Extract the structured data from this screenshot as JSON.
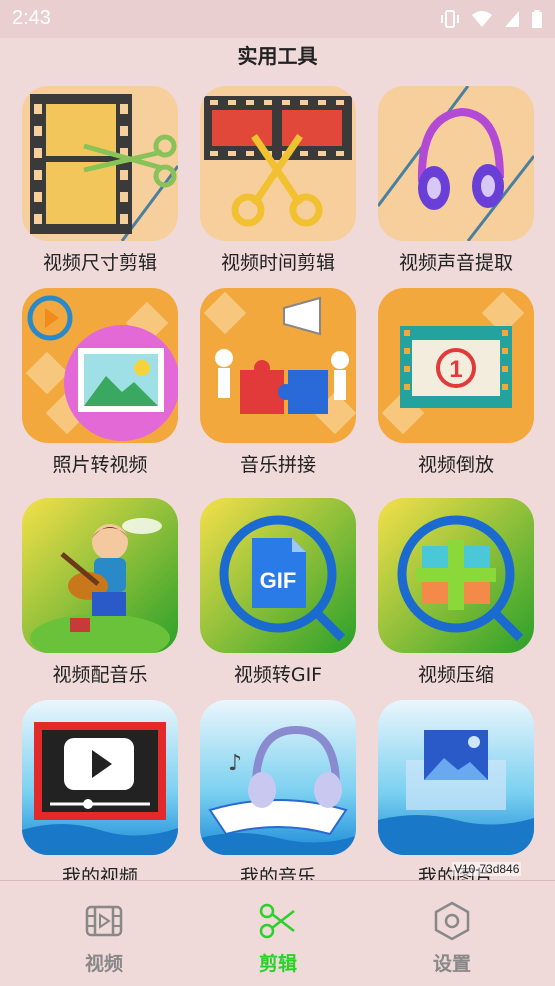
{
  "status_bar": {
    "time": "2:43"
  },
  "page_title": "实用工具",
  "tools": [
    {
      "label": "视频尺寸剪辑",
      "icon": "film-scissors-icon"
    },
    {
      "label": "视频时间剪辑",
      "icon": "film-cut-icon"
    },
    {
      "label": "视频声音提取",
      "icon": "headphones-icon"
    },
    {
      "label": "照片转视频",
      "icon": "photo-video-icon"
    },
    {
      "label": "音乐拼接",
      "icon": "puzzle-icon"
    },
    {
      "label": "视频倒放",
      "icon": "film-countdown-icon"
    },
    {
      "label": "视频配音乐",
      "icon": "boy-guitar-icon"
    },
    {
      "label": "视频转GIF",
      "icon": "gif-file-icon"
    },
    {
      "label": "视频压缩",
      "icon": "compress-icon"
    },
    {
      "label": "我的视频",
      "icon": "my-video-icon"
    },
    {
      "label": "我的音乐",
      "icon": "my-music-icon"
    },
    {
      "label": "我的图片",
      "icon": "my-picture-icon"
    }
  ],
  "watermark": "V10-73d846",
  "bottom_nav": [
    {
      "label": "视频",
      "icon": "film-icon",
      "active": false
    },
    {
      "label": "剪辑",
      "icon": "scissors-icon",
      "active": true
    },
    {
      "label": "设置",
      "icon": "settings-hexagon-icon",
      "active": false
    }
  ],
  "colors": {
    "active": "#2ad12a",
    "inactive": "#888888",
    "background": "#efd9d9"
  }
}
